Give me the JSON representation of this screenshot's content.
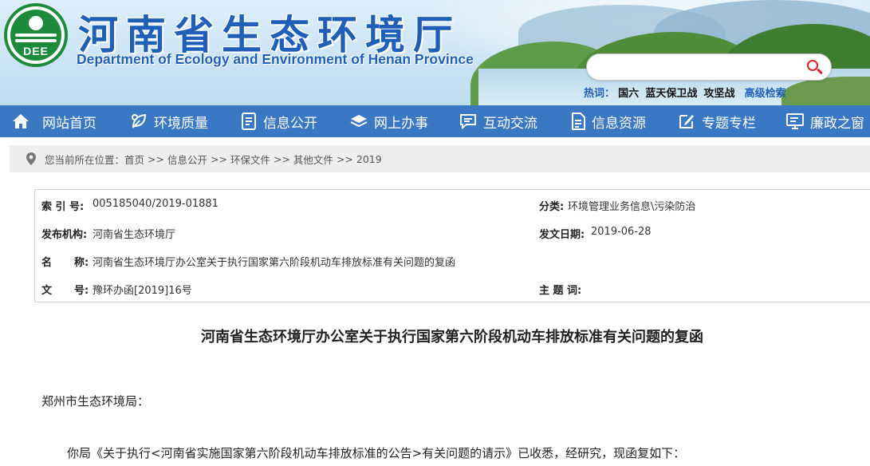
{
  "header": {
    "title": "河南省生态环境厅",
    "subtitle": "Department of Ecology and Environment of Henan Province",
    "logo_text": "DEE",
    "search": {
      "placeholder": "",
      "value": ""
    },
    "hot_label": "热词：",
    "hot_words": [
      "国六",
      "蓝天保卫战",
      "攻坚战"
    ],
    "advanced_search": "高级检索"
  },
  "nav": {
    "items": [
      {
        "label": "网站首页",
        "icon": "home-icon"
      },
      {
        "label": "环境质量",
        "icon": "leaf-icon"
      },
      {
        "label": "信息公开",
        "icon": "document-icon"
      },
      {
        "label": "网上办事",
        "icon": "layers-icon"
      },
      {
        "label": "互动交流",
        "icon": "chat-icon"
      },
      {
        "label": "信息资源",
        "icon": "file-icon"
      },
      {
        "label": "专题专栏",
        "icon": "edit-icon"
      },
      {
        "label": "廉政之窗",
        "icon": "monitor-icon"
      }
    ],
    "color": "#3a78c3"
  },
  "breadcrumb": {
    "prefix": "您当前所在位置：",
    "items": [
      "首页",
      "信息公开",
      "环保文件",
      "其他文件",
      "2019"
    ],
    "separator": ">>"
  },
  "meta": {
    "index_label": "索 引 号:",
    "index_value": "005185040/2019-01881",
    "category_label": "分类:",
    "category_value": "环境管理业务信息\\污染防治",
    "publisher_label": "发布机构:",
    "publisher_value": "河南省生态环境厅",
    "date_label": "发文日期:",
    "date_value": "2019-06-28",
    "name_label_1": "名",
    "name_label_2": "称:",
    "name_value": "河南省生态环境厅办公室关于执行国家第六阶段机动车排放标准有关问题的复函",
    "docno_label_1": "文",
    "docno_label_2": "号:",
    "docno_value": "豫环办函[2019]16号",
    "keyword_label": "主 题 词:",
    "keyword_value": ""
  },
  "article": {
    "title": "河南省生态环境厅办公室关于执行国家第六阶段机动车排放标准有关问题的复函",
    "salutation": "郑州市生态环境局：",
    "paragraph1": "你局《关于执行<河南省实施国家第六阶段机动车排放标准的公告>有关问题的请示》已收悉，经研究，现函复如下："
  }
}
